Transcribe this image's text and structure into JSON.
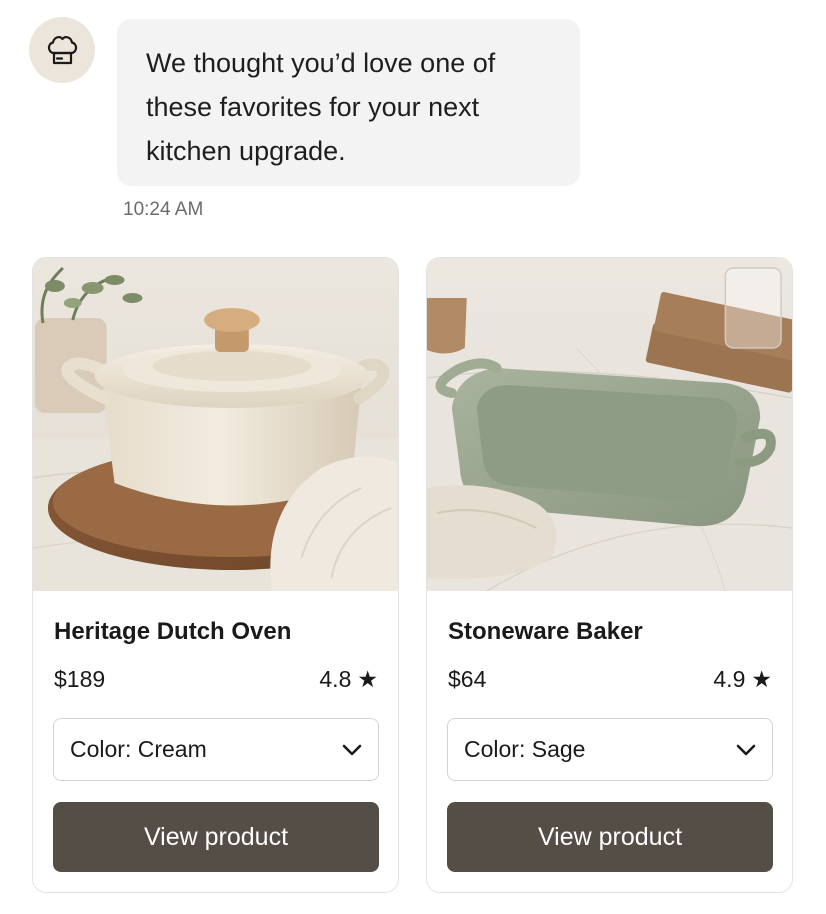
{
  "assistant": {
    "avatar_icon": "chef-hat-icon",
    "message": "We thought you’d love one of these favorites for your next kitchen upgrade.",
    "timestamp": "10:24 AM"
  },
  "products": [
    {
      "name": "Heritage Dutch Oven",
      "price": "$189",
      "rating": "4.8",
      "rating_icon": "star-icon",
      "image": "dutch-oven-photo",
      "color_select": {
        "selected": "Color: Cream"
      },
      "cta_label": "View product"
    },
    {
      "name": "Stoneware Baker",
      "price": "$64",
      "rating": "4.9",
      "rating_icon": "star-icon",
      "image": "baking-dish-photo",
      "color_select": {
        "selected": "Color: Sage"
      },
      "cta_label": "View product"
    }
  ],
  "colors": {
    "avatar_bg": "#ece5db",
    "bubble_bg": "#f3f3f3",
    "button_bg": "#554e46",
    "cream": "#ece2cf",
    "sage": "#98a58d"
  }
}
